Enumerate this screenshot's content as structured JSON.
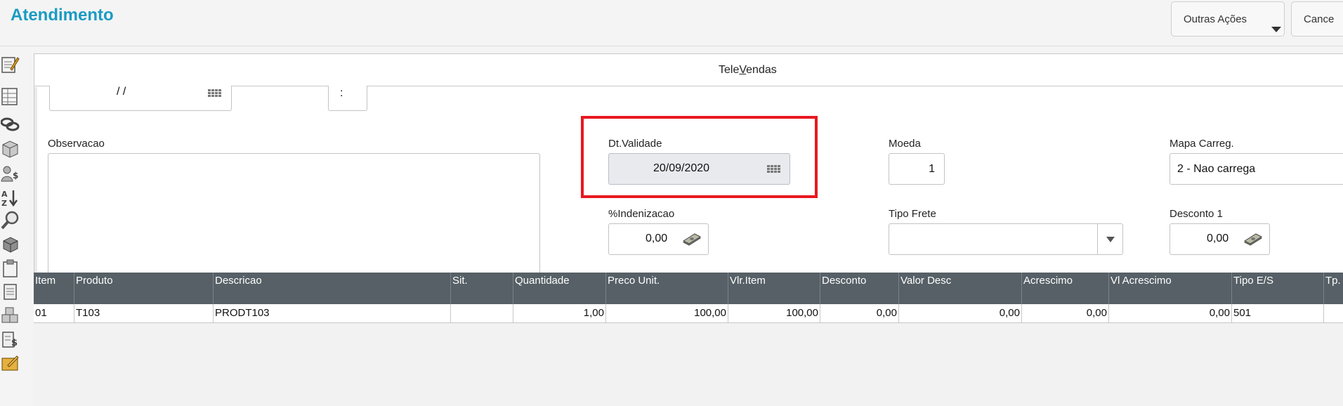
{
  "header": {
    "title": "Atendimento",
    "outras_acoes_label": "Outras Ações",
    "cancel_label": "Cance"
  },
  "panel": {
    "title_pre": "Tele",
    "title_underlined": "V",
    "title_post": "endas"
  },
  "form": {
    "date_value": "/ /",
    "time_value": ":",
    "observacao_label": "Observacao",
    "observacao_value": "",
    "dt_validade_label": "Dt.Validade",
    "dt_validade_value": "20/09/2020",
    "moeda_label": "Moeda",
    "moeda_value": "1",
    "mapa_carreg_label": "Mapa Carreg.",
    "mapa_carreg_value": "2 - Nao carrega",
    "indenizacao_label": "%Indenizacao",
    "indenizacao_value": "0,00",
    "tipo_frete_label": "Tipo Frete",
    "tipo_frete_value": "",
    "desconto1_label": "Desconto 1",
    "desconto1_value": "0,00"
  },
  "grid": {
    "columns": [
      "Item",
      "Produto",
      "Descricao",
      "Sit.",
      "Quantidade",
      "Preco Unit.",
      "Vlr.Item",
      "Desconto",
      "Valor Desc",
      "Acrescimo",
      "Vl Acrescimo",
      "Tipo E/S",
      "Tp."
    ],
    "rows": [
      [
        "01",
        "T103",
        "PRODT103",
        "",
        "1,00",
        "100,00",
        "100,00",
        "0,00",
        "0,00",
        "0,00",
        "0,00",
        "501",
        ""
      ]
    ]
  },
  "colors": {
    "title": "#1b9bc3",
    "grid_header": "#566066",
    "highlight": "#e81820"
  }
}
